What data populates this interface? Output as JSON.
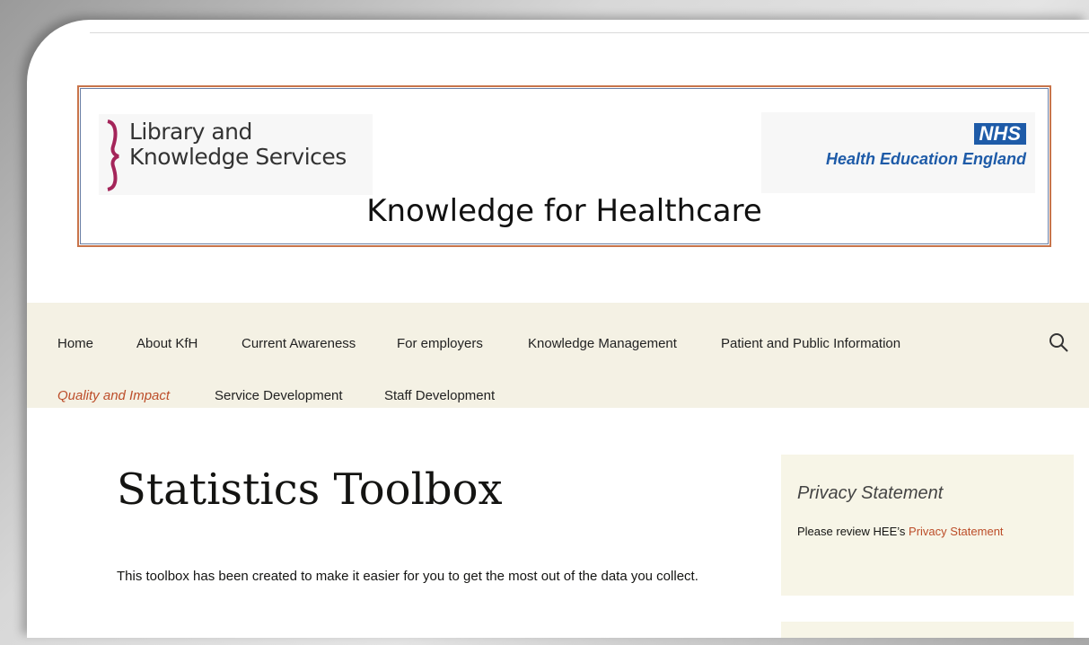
{
  "banner": {
    "lks_logo": {
      "line1": "Library and",
      "line2": "Knowledge Services"
    },
    "nhs_logo": {
      "badge": "NHS",
      "org": "Health Education England"
    },
    "title": "Knowledge for Healthcare"
  },
  "nav": {
    "row1": [
      "Home",
      "About KfH",
      "Current Awareness",
      "For employers",
      "Knowledge Management",
      "Patient and Public Information"
    ],
    "row2": [
      "Quality and Impact",
      "Service Development",
      "Staff Development"
    ],
    "active": "Quality and Impact",
    "search_icon": "search-icon"
  },
  "main": {
    "title": "Statistics Toolbox",
    "intro": "This toolbox has been created to make it easier for you to get the most out of the data you collect."
  },
  "sidebar": {
    "widget_title": "Privacy Statement",
    "text_prefix": "Please review HEE’s ",
    "link_text": "Privacy Statement"
  },
  "colors": {
    "accent": "#bc4d29",
    "nav_bg": "#f4f1e4",
    "sidebar_bg": "#f7f5e7",
    "nhs_blue": "#1e5ba8"
  }
}
